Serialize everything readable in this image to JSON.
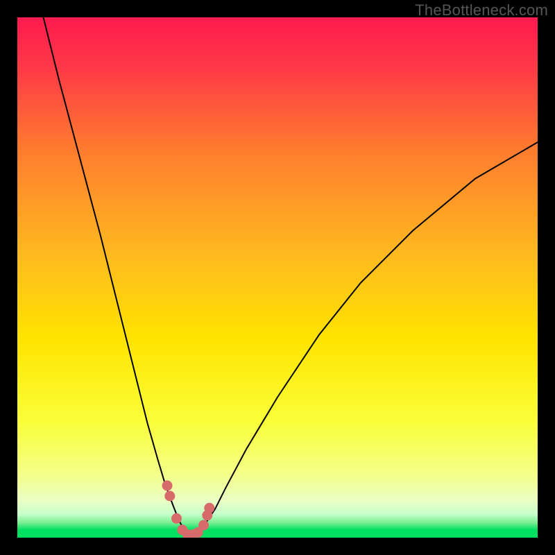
{
  "watermark": "TheBottleneck.com",
  "colors": {
    "black": "#000000",
    "curve": "#000000",
    "marker_fill": "#d76a6a",
    "marker_stroke": "#c95a5a",
    "green_band": "#00e35a",
    "green_band_light": "#77ee77",
    "gradient_top": "#ff1a4f",
    "gradient_mid1": "#ff8a2a",
    "gradient_mid2": "#ffe400",
    "gradient_low": "#f3ff8a"
  },
  "chart_data": {
    "type": "line",
    "title": "",
    "xlabel": "",
    "ylabel": "",
    "xlim": [
      0,
      100
    ],
    "ylim": [
      0,
      100
    ],
    "grid": false,
    "note": "V-shaped bottleneck curve. Minimum (≈0) near x≈33. Values read from pixel positions; axes are unlabeled so units are percentage of plot height.",
    "series": [
      {
        "name": "curve",
        "x": [
          5,
          8,
          12,
          16,
          20,
          23,
          25,
          27,
          28.5,
          30,
          31,
          32,
          33,
          34,
          35,
          36,
          38,
          40,
          44,
          50,
          58,
          66,
          76,
          88,
          100
        ],
        "y": [
          100,
          88,
          73,
          58,
          42,
          30,
          22,
          15,
          10,
          6,
          3.5,
          1.5,
          0.5,
          0.5,
          1,
          2.5,
          5.5,
          9.5,
          17,
          27,
          39,
          49,
          59,
          69,
          76
        ]
      }
    ],
    "markers": {
      "name": "highlighted-points",
      "x": [
        28.8,
        29.3,
        30.6,
        31.7,
        32.7,
        33.8,
        34.7,
        35.8,
        36.5,
        36.9
      ],
      "y": [
        10.0,
        8.0,
        3.7,
        1.5,
        0.6,
        0.6,
        1.0,
        2.4,
        4.3,
        5.7
      ]
    }
  }
}
